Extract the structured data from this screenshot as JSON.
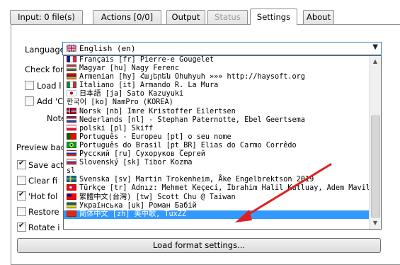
{
  "tabs": [
    {
      "label": "Input: 0 file(s)",
      "state": "normal"
    },
    {
      "label": "Actions [0/0]",
      "state": "normal"
    },
    {
      "label": "Output",
      "state": "normal"
    },
    {
      "label": "Status",
      "state": "disabled"
    },
    {
      "label": "Settings",
      "state": "active"
    },
    {
      "label": "About",
      "state": "normal"
    }
  ],
  "settings": {
    "language_label": "Language",
    "language_value": "English (en)",
    "check_for_label": "Check for",
    "load_label": "Load l",
    "add_label": "Add 'C",
    "note_label": "Note",
    "preview_label": "Preview bac",
    "save_label": "Save act",
    "clear_label": "Clear fi",
    "hot_folder_label": "'Hot fol",
    "restore_label": "Restore",
    "rotate_label": "Rotate i",
    "load_format_button": "Load format settings..."
  },
  "language_list": [
    {
      "text": "Français [fr] Pierre-e Gougelet",
      "flag": "fr"
    },
    {
      "text": "Magyar [hu] Nagy Ferenc",
      "flag": "hu"
    },
    {
      "text": "Armenian [hy] Հայերեն Ohuhyuh »»» http://haysoft.org",
      "flag": "hy"
    },
    {
      "text": "Italiano [it] Armando R. La Mura",
      "flag": "it"
    },
    {
      "text": "日本語 [ja] Sato Kazuyuki",
      "flag": "ja"
    },
    {
      "text": "한국어 [ko] NamPro (KOREA)",
      "flag": ""
    },
    {
      "text": "Norsk [nb] Imre Kristoffer Eilertsen",
      "flag": "nb"
    },
    {
      "text": "Nederlands [nl]  - Stephan Paternotte, Ebel Geertsema",
      "flag": "nl"
    },
    {
      "text": "polski [pl] Skiff",
      "flag": "pl"
    },
    {
      "text": "Português - Europeu [pt] o seu nome",
      "flag": "pt"
    },
    {
      "text": "Português do Brasil [pt_BR] Elias do Carmo Corrêdo",
      "flag": "br"
    },
    {
      "text": "Русский [ru] Сухоруков Сергей",
      "flag": "ru"
    },
    {
      "text": "Slovenský [sk] Tibor Kozma",
      "flag": "sk"
    },
    {
      "text": "sl",
      "flag": ""
    },
    {
      "text": "Svenska [sv] Martin Trokenheim, Åke Engelbrektson 2019",
      "flag": "sv"
    },
    {
      "text": "Türkçe [tr] Adnız: Mehmet Keçeci, İbrahim Halil Kutluay, Adem Mavili",
      "flag": "tr"
    },
    {
      "text": "繁體中文(台灣) [tw] Scott Chu @ Taiwan",
      "flag": "tw"
    },
    {
      "text": "Українська [uk] Роман Бабій",
      "flag": "uk"
    },
    {
      "text": "简体中文 [zh] 美中歌, TuxZZ",
      "flag": "zh",
      "selected": true
    }
  ],
  "colors": {
    "selection": "#3399ff",
    "arrow": "#e02020"
  },
  "icons": {
    "dropdown_arrow": "chevron-down-icon",
    "scroll_up": "scroll-up-icon",
    "scroll_down": "scroll-down-icon"
  }
}
